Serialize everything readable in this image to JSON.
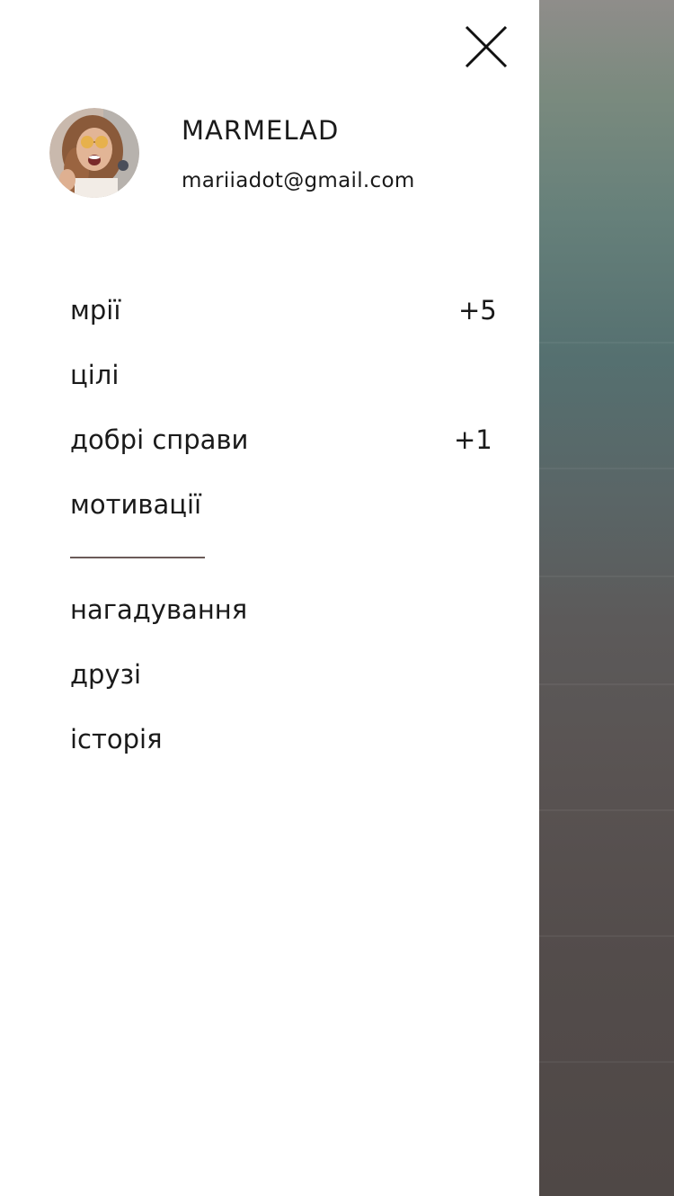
{
  "profile": {
    "name": "MARMELAD",
    "email": "mariiadot@gmail.com"
  },
  "menu": {
    "primary": [
      {
        "label": "мрії",
        "badge": "+5"
      },
      {
        "label": "цілі",
        "badge": ""
      },
      {
        "label": "добрі справи",
        "badge": "+1"
      },
      {
        "label": "мотивації",
        "badge": ""
      }
    ],
    "secondary": [
      {
        "label": "нагадування"
      },
      {
        "label": "друзі"
      },
      {
        "label": "історія"
      }
    ]
  },
  "icons": {
    "close": "close-icon",
    "avatar": "user-avatar"
  },
  "colors": {
    "divider": "#6b5b58",
    "text": "#1a1a1a"
  }
}
